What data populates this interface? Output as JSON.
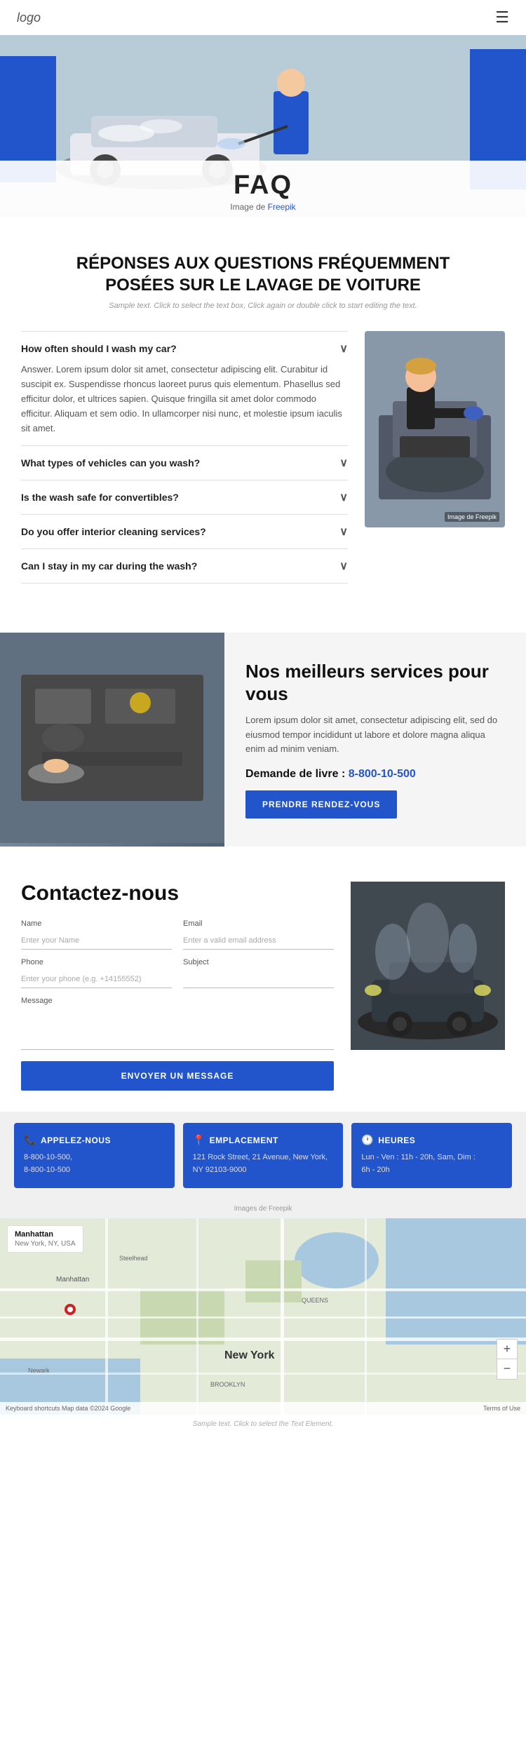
{
  "header": {
    "logo": "logo",
    "menu_icon": "☰"
  },
  "hero": {
    "title": "FAQ",
    "subtitle": "Image de ",
    "subtitle_link": "Freepik"
  },
  "faq_section": {
    "title": "RÉPONSES AUX QUESTIONS FRÉQUEMMENT POSÉES SUR LE LAVAGE DE VOITURE",
    "sample_text": "Sample text. Click to select the text box, Click again or double click to start editing the text.",
    "items": [
      {
        "question": "How often should I wash my car?",
        "answer": "Answer. Lorem ipsum dolor sit amet, consectetur adipiscing elit. Curabitur id suscipit ex. Suspendisse rhoncus laoreet purus quis elementum. Phasellus sed efficitur dolor, et ultrices sapien. Quisque fringilla sit amet dolor commodo efficitur. Aliquam et sem odio. In ullamcorper nisi nunc, et molestie ipsum iaculis sit amet.",
        "open": true
      },
      {
        "question": "What types of vehicles can you wash?",
        "answer": "",
        "open": false
      },
      {
        "question": "Is the wash safe for convertibles?",
        "answer": "",
        "open": false
      },
      {
        "question": "Do you offer interior cleaning services?",
        "answer": "",
        "open": false
      },
      {
        "question": "Can I stay in my car during the wash?",
        "answer": "",
        "open": false
      }
    ],
    "image_label": "Image de Freepik"
  },
  "services": {
    "title": "Nos meilleurs services pour vous",
    "description": "Lorem ipsum dolor sit amet, consectetur adipiscing elit, sed do eiusmod tempor incididunt ut labore et dolore magna aliqua enim ad minim veniam.",
    "phone_label": "Demande de livre :",
    "phone_number": "8-800-10-500",
    "button_label": "PRENDRE RENDEZ-VOUS"
  },
  "contact": {
    "title": "Contactez-nous",
    "fields": {
      "name_label": "Name",
      "name_placeholder": "Enter your Name",
      "email_label": "Email",
      "email_placeholder": "Enter a valid email address",
      "phone_label": "Phone",
      "phone_placeholder": "Enter your phone (e.g. +14155552)",
      "subject_label": "Subject",
      "subject_placeholder": "",
      "message_label": "Message",
      "message_placeholder": ""
    },
    "button_label": "ENVOYER UN MESSAGE"
  },
  "info_cards": [
    {
      "icon": "📞",
      "header": "APPELEZ-NOUS",
      "lines": [
        "8-800-10-500,",
        "8-800-10-500"
      ]
    },
    {
      "icon": "📍",
      "header": "EMPLACEMENT",
      "lines": [
        "121 Rock Street, 21 Avenue, New York,",
        "NY 92103-9000"
      ]
    },
    {
      "icon": "🕐",
      "header": "HEURES",
      "lines": [
        "Lun - Ven : 11h - 20h, Sam, Dim :",
        "6h - 20h"
      ]
    }
  ],
  "info_cards_label": "Images de Freepik",
  "map": {
    "location_title": "Manhattan",
    "location_sub": "New York, NY, USA",
    "city_label": "New York",
    "zoom_plus": "+",
    "zoom_minus": "−",
    "bottom_left": "Keyboard shortcuts  Map data ©2024 Google",
    "bottom_right": "Terms of Use"
  },
  "sample_text_bottom": "Sample text. Click to select the Text Element."
}
